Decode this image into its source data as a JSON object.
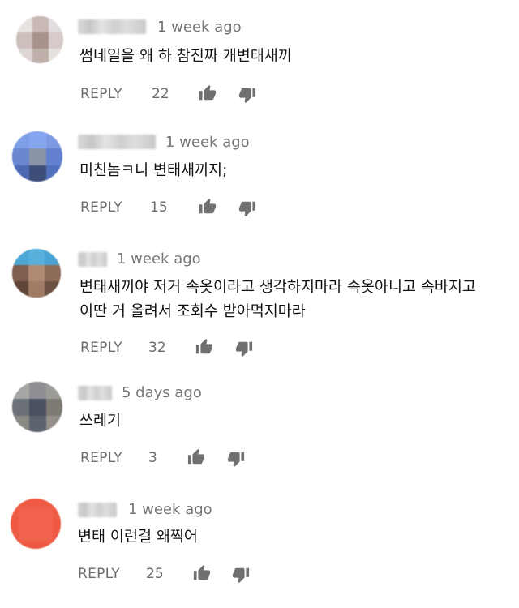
{
  "comments": [
    {
      "time": "1 week ago",
      "text": "썸네일을 왜 하 참진짜 개변태새끼",
      "reply_label": "REPLY",
      "likes": "22",
      "like_icon": "thumb-up-icon",
      "dislike_icon": "thumb-down-icon"
    },
    {
      "time": "1 week ago",
      "text": "미친놈ㅋ니 변태새끼지;",
      "reply_label": "REPLY",
      "likes": "15",
      "like_icon": "thumb-up-icon",
      "dislike_icon": "thumb-down-icon"
    },
    {
      "time": "1 week ago",
      "text": "변태새끼야 저거 속옷이라고 생각하지마라 속옷아니고 속바지고\n이딴 거 올려서 조회수 받아먹지마라",
      "reply_label": "REPLY",
      "likes": "32",
      "like_icon": "thumb-up-icon",
      "dislike_icon": "thumb-down-icon"
    },
    {
      "time": "5 days ago",
      "text": "쓰레기",
      "reply_label": "REPLY",
      "likes": "3",
      "like_icon": "thumb-up-icon",
      "dislike_icon": "thumb-down-icon"
    },
    {
      "time": "1 week ago",
      "text": "변태 이런걸 왜찍어",
      "reply_label": "REPLY",
      "likes": "25",
      "like_icon": "thumb-up-icon",
      "dislike_icon": "thumb-down-icon"
    }
  ],
  "colors": {
    "timestamp": "#777777",
    "text": "#111111",
    "action": "#6b6b6b",
    "avatar_5": "#ef5a45"
  }
}
